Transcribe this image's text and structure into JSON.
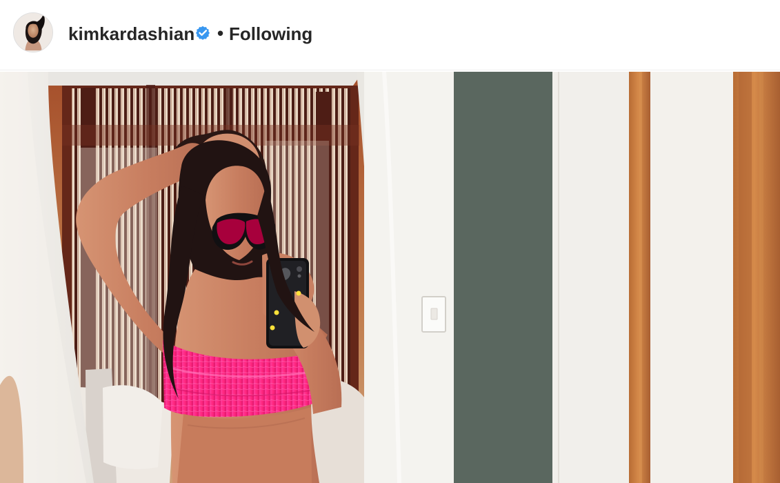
{
  "post": {
    "header": {
      "username": "kimkardashian",
      "separator": "•",
      "follow_status": "Following",
      "verified": true,
      "avatar_icon": "profile-photo-avatar",
      "verified_icon": "verified-badge-icon"
    },
    "image": {
      "description_icon": "mirror-selfie-photo"
    }
  },
  "colors": {
    "username_text": "#262626",
    "verified_blue": "#3897f0",
    "header_background": "#ffffff",
    "header_border": "#efefef",
    "swimsuit_pink": "#ff2f89",
    "wall_white": "#f4f2ee",
    "wall_green_gray": "#5a675f",
    "wood_trim": "#c47d43"
  }
}
